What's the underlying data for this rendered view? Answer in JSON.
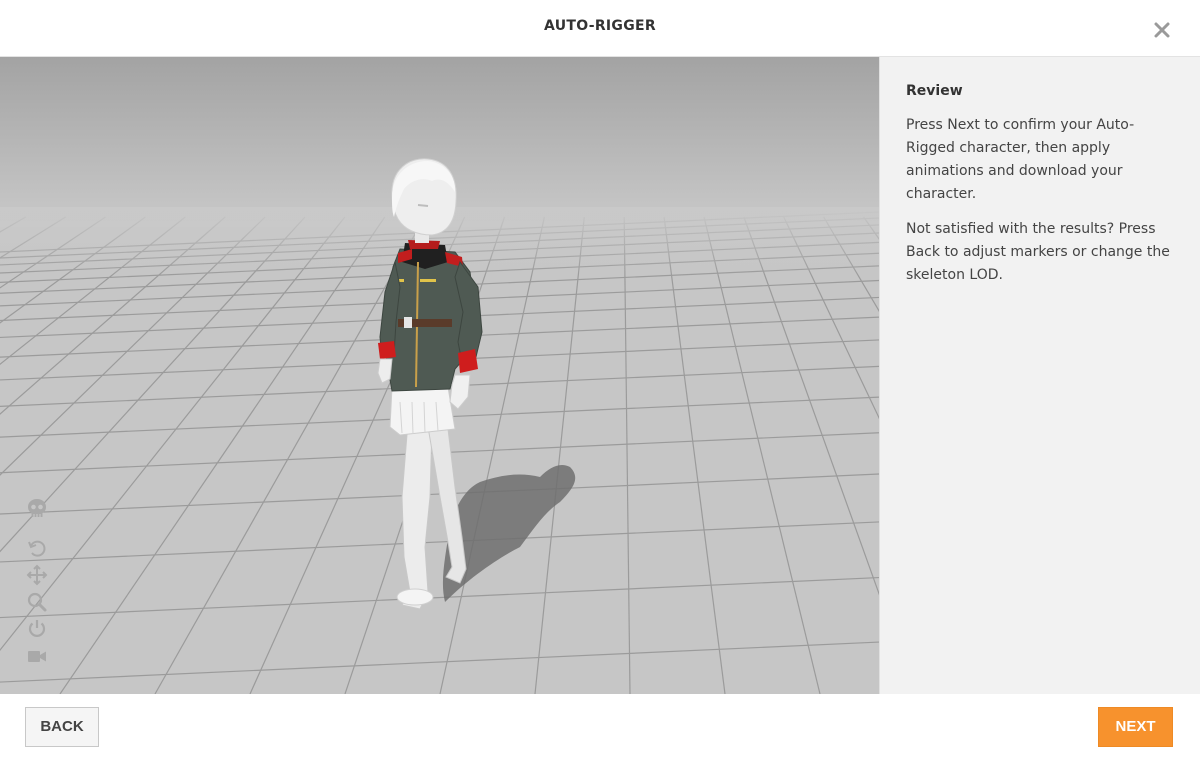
{
  "header": {
    "title": "AUTO-RIGGER",
    "close_icon": "close-icon"
  },
  "viewport": {
    "tools": [
      "skeleton-icon",
      "rotate-icon",
      "pan-icon",
      "zoom-icon",
      "power-icon",
      "camera-icon"
    ]
  },
  "panel": {
    "title": "Review",
    "paragraph1": "Press Next to confirm your Auto-Rigged character, then apply animations and download your character.",
    "paragraph2": "Not satisfied with the results? Press Back to adjust markers or change the skeleton LOD."
  },
  "footer": {
    "back_label": "BACK",
    "next_label": "NEXT"
  },
  "colors": {
    "accent": "#f7922d",
    "panel_bg": "#f2f2f2",
    "floor": "#c4c4c4"
  }
}
